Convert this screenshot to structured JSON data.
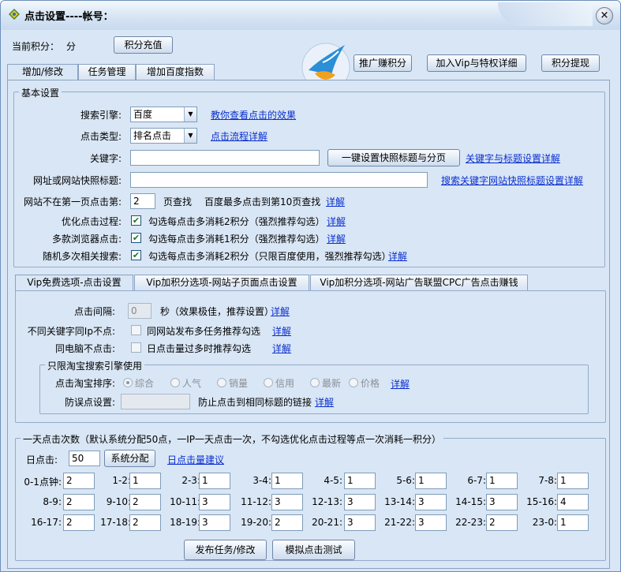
{
  "window": {
    "title": "点击设置----帐号：",
    "close": "×"
  },
  "header": {
    "points_label": "当前积分：",
    "points_unit": "分",
    "recharge": "积分充值",
    "promote": "推广赚积分",
    "vip": "加入Vip与特权详细",
    "withdraw": "积分提现"
  },
  "tabs": [
    {
      "label": "增加/修改",
      "active": true
    },
    {
      "label": "任务管理",
      "active": false
    },
    {
      "label": "增加百度指数",
      "active": false
    }
  ],
  "basic": {
    "title": "基本设置",
    "engine_label": "搜索引擎:",
    "engine_value": "百度",
    "engine_link": "教你查看点击的效果",
    "type_label": "点击类型:",
    "type_value": "排名点击",
    "type_link": "点击流程详解",
    "keyword_label": "关键字:",
    "keyword_value": "",
    "keyword_btn": "一键设置快照标题与分页",
    "keyword_link": "关键字与标题设置详解",
    "url_label": "网址或网站快照标题:",
    "url_value": "",
    "url_link": "搜索关键字网站快照标题设置详解",
    "page_label": "网站不在第一页点击第:",
    "page_value": "2",
    "page_suffix": "页查找",
    "page_note": "百度最多点击到第10页查找",
    "page_link": "详解",
    "opt_label": "优化点击过程:",
    "opt_text": "勾选每点击多消耗2积分（强烈推荐勾选）",
    "opt_link": "详解",
    "opt_checked": true,
    "browser_label": "多款浏览器点击:",
    "browser_text": "勾选每点击多消耗1积分（强烈推荐勾选）",
    "browser_link": "详解",
    "browser_checked": true,
    "random_label": "随机多次相关搜索:",
    "random_text": "勾选每点击多消耗2积分（只限百度使用，强烈推荐勾选）",
    "random_link": "详解",
    "random_checked": true
  },
  "vip_tabs": [
    {
      "label": "Vip免费选项-点击设置",
      "active": true
    },
    {
      "label": "Vip加积分选项-网站子页面点击设置",
      "active": false
    },
    {
      "label": "Vip加积分选项-网站广告联盟CPC广告点击赚钱",
      "active": false
    }
  ],
  "vip": {
    "interval_label": "点击间隔:",
    "interval_value": "0",
    "interval_note": "秒（效果极佳，推荐设置）",
    "interval_link": "详解",
    "ip_label": "不同关键字同Ip不点:",
    "ip_text": "同网站发布多任务推荐勾选",
    "ip_link": "详解",
    "pc_label": "同电脑不点击:",
    "pc_text": "日点击量过多时推荐勾选",
    "pc_link": "详解",
    "taobao_title": "只限淘宝搜索引擎使用",
    "sort_label": "点击淘宝排序:",
    "sort_options": [
      "综合",
      "人气",
      "销量",
      "信用",
      "最新",
      "价格"
    ],
    "sort_selected": 0,
    "sort_link": "详解",
    "mis_label": "防误点设置:",
    "mis_value": "",
    "mis_text": "防止点击到相同标题的链接",
    "mis_link": "详解"
  },
  "daily": {
    "title": "一天点击次数（默认系统分配50点，一IP一天点击一次，不勾选优化点击过程等点一次消耗一积分）",
    "label": "日点击:",
    "value": "50",
    "system_btn": "系统分配",
    "advice_link": "日点击量建议",
    "hours": [
      {
        "label": "0-1点钟:",
        "value": "2"
      },
      {
        "label": "1-2:",
        "value": "1"
      },
      {
        "label": "2-3:",
        "value": "1"
      },
      {
        "label": "3-4:",
        "value": "1"
      },
      {
        "label": "4-5:",
        "value": "1"
      },
      {
        "label": "5-6:",
        "value": "1"
      },
      {
        "label": "6-7:",
        "value": "1"
      },
      {
        "label": "7-8:",
        "value": "1"
      },
      {
        "label": "8-9:",
        "value": "2"
      },
      {
        "label": "9-10:",
        "value": "2"
      },
      {
        "label": "10-11:",
        "value": "3"
      },
      {
        "label": "11-12:",
        "value": "3"
      },
      {
        "label": "12-13:",
        "value": "3"
      },
      {
        "label": "13-14:",
        "value": "3"
      },
      {
        "label": "14-15:",
        "value": "3"
      },
      {
        "label": "15-16:",
        "value": "4"
      },
      {
        "label": "16-17:",
        "value": "2"
      },
      {
        "label": "17-18:",
        "value": "2"
      },
      {
        "label": "18-19:",
        "value": "3"
      },
      {
        "label": "19-20:",
        "value": "2"
      },
      {
        "label": "20-21:",
        "value": "3"
      },
      {
        "label": "21-22:",
        "value": "3"
      },
      {
        "label": "22-23:",
        "value": "2"
      },
      {
        "label": "23-0:",
        "value": "1"
      }
    ]
  },
  "footer": {
    "publish": "发布任务/修改",
    "simulate": "模拟点击测试"
  },
  "icons": {
    "title_icon": "app-logo-icon",
    "logo": "bird-logo-icon",
    "check": "✔",
    "dropdown": "▼"
  },
  "colors": {
    "link": "#0a2fcf",
    "panel_bg": "#d9e6f5",
    "border": "#8aa2c2"
  }
}
